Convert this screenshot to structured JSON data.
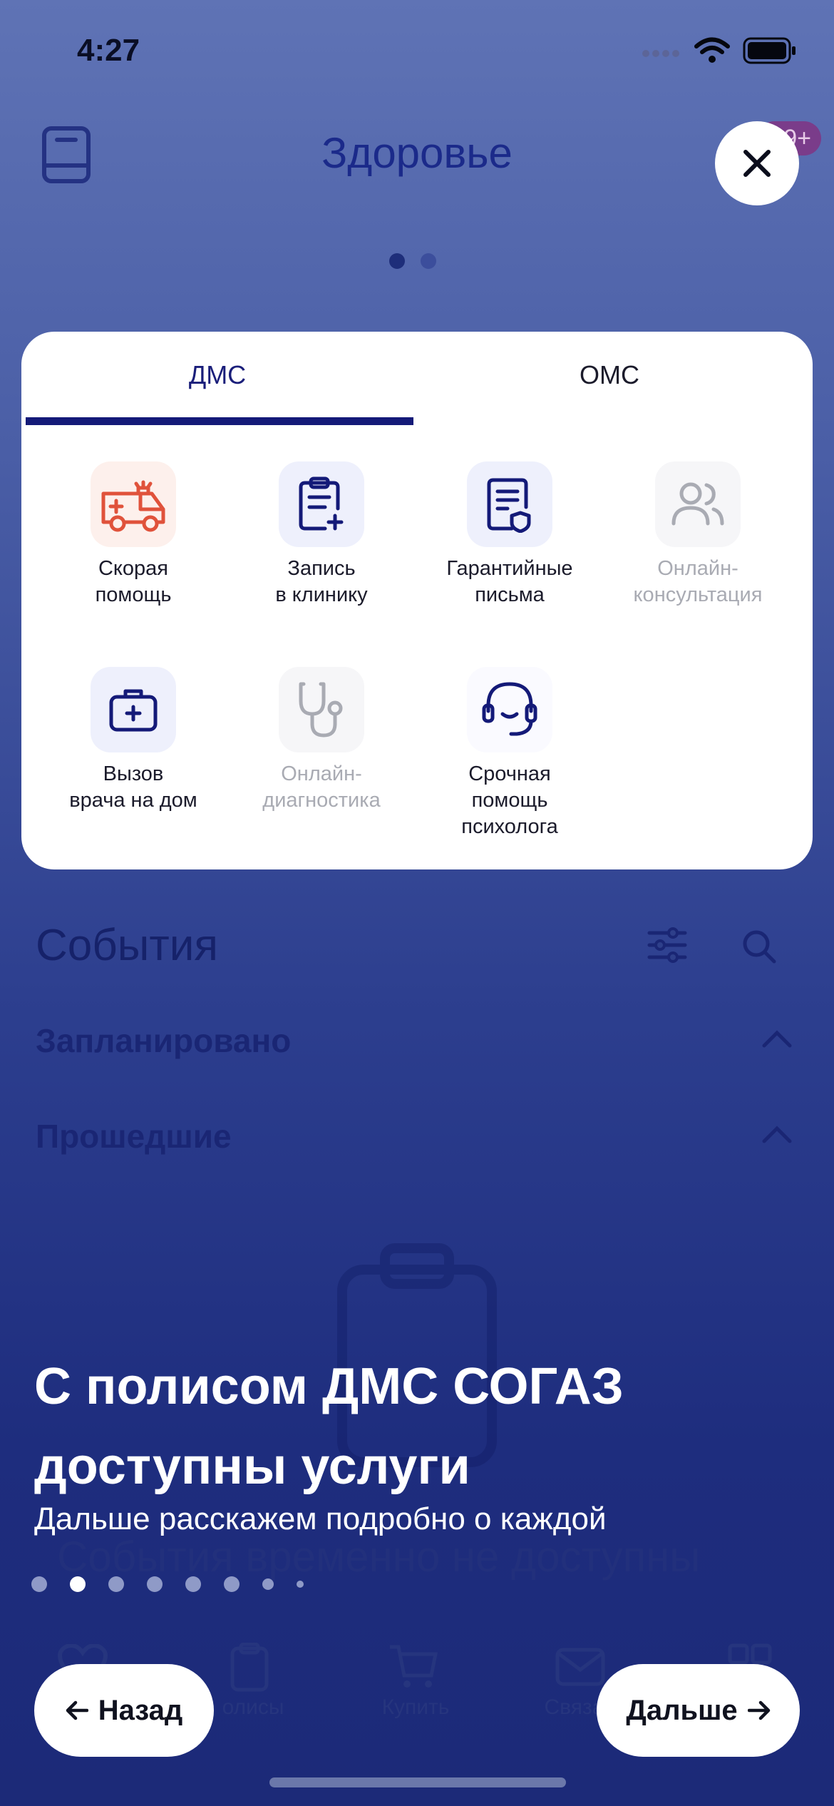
{
  "status_bar": {
    "time": "4:27"
  },
  "header": {
    "title": "Здоровье",
    "badge": "9+"
  },
  "card": {
    "tabs": [
      {
        "label": "ДМС"
      },
      {
        "label": "ОМС"
      }
    ],
    "services": [
      {
        "label": "Скорая\nпомощь",
        "icon": "ambulance-icon",
        "enabled": true
      },
      {
        "label": "Запись\nв клинику",
        "icon": "clipboard-plus-icon",
        "enabled": true
      },
      {
        "label": "Гарантийные\nписьма",
        "icon": "document-shield-icon",
        "enabled": true
      },
      {
        "label": "Онлайн-\nконсультация",
        "icon": "users-icon",
        "enabled": false
      },
      {
        "label": "Вызов\nврача на дом",
        "icon": "medkit-icon",
        "enabled": true
      },
      {
        "label": "Онлайн-\nдиагностика",
        "icon": "stethoscope-icon",
        "enabled": false
      },
      {
        "label": "Срочная\nпомощь\nпсихолога",
        "icon": "headset-icon",
        "enabled": true
      }
    ]
  },
  "events": {
    "title": "События",
    "sections": [
      {
        "label": "Запланировано"
      },
      {
        "label": "Прошедшие"
      }
    ],
    "empty_text": "События временно не доступны"
  },
  "tabbar": [
    {
      "label": "олисы"
    },
    {
      "label": "Купить"
    },
    {
      "label": "Связат"
    }
  ],
  "onboarding": {
    "title": "С полисом ДМС СОГАЗ доступны услуги",
    "subtitle": "Дальше расскажем подробно о каждой",
    "back_label": "Назад",
    "next_label": "Дальше"
  },
  "colors": {
    "accent": "#141a78",
    "danger": "#e0523b",
    "disabled": "#a9abb3"
  }
}
